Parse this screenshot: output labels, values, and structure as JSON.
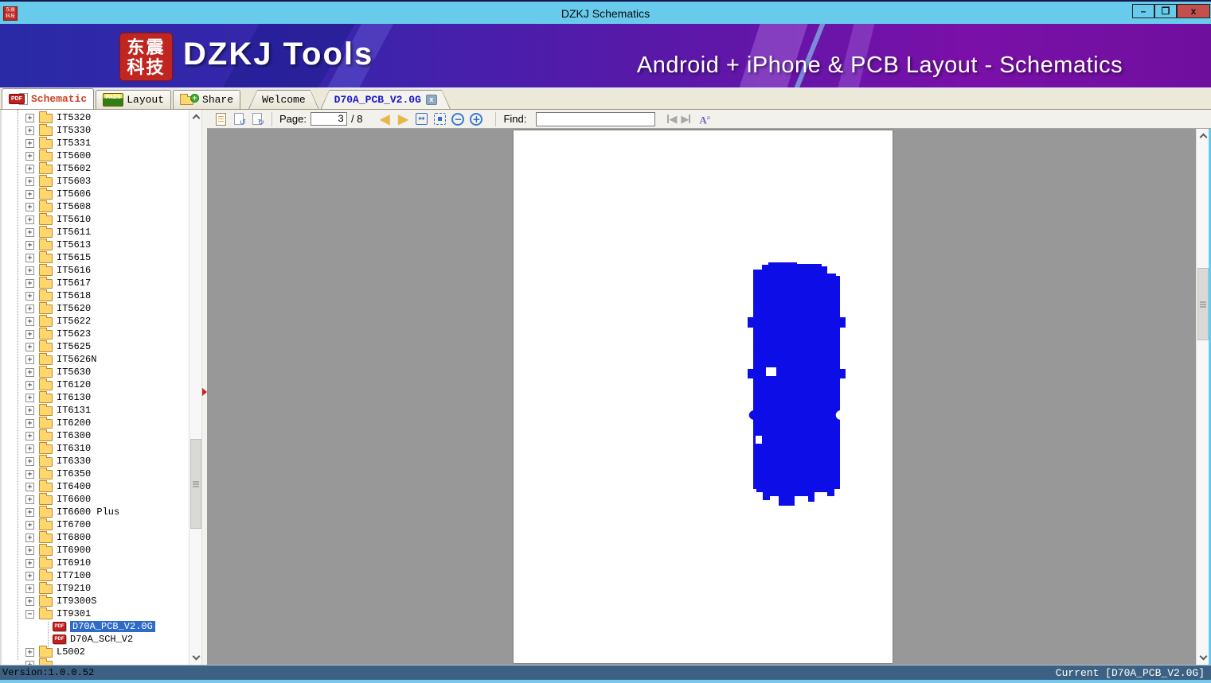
{
  "window": {
    "title": "DZKJ Schematics",
    "controls": {
      "minimize": "–",
      "maximize": "❐",
      "close": "x"
    }
  },
  "banner": {
    "logo_line1": "东震",
    "logo_line2": "科技",
    "app_name": "DZKJ Tools",
    "tagline": "Android + iPhone & PCB Layout - Schematics"
  },
  "tabs": {
    "main": [
      {
        "label": "Schematic",
        "icon": "pdf",
        "active": true
      },
      {
        "label": "Layout",
        "icon": "pads",
        "active": false
      },
      {
        "label": "Share",
        "icon": "share-folder",
        "active": false
      }
    ],
    "documents": [
      {
        "label": "Welcome",
        "active": false
      },
      {
        "label": "D70A_PCB_V2.0G",
        "active": true,
        "close_glyph": "x"
      }
    ]
  },
  "toolbar": {
    "page_label": "Page:",
    "page_value": "3",
    "page_total": "/ 8",
    "find_label": "Find:",
    "find_value": "",
    "pads_icon_text": "PADS",
    "pdf_badge_text": "PDF",
    "fit_width_glyph": "↔",
    "zoom_out_glyph": "−",
    "zoom_in_glyph": "+",
    "prev_glyph": "◀",
    "next_glyph": "▶",
    "case_glyph": "A",
    "case_sup_glyph": "a",
    "rotate_left_glyph": "↺",
    "rotate_right_glyph": "↻",
    "share_plus_glyph": "+"
  },
  "tree": {
    "items": [
      {
        "label": "IT5320",
        "type": "folder",
        "state": "collapsed"
      },
      {
        "label": "IT5330",
        "type": "folder",
        "state": "collapsed"
      },
      {
        "label": "IT5331",
        "type": "folder",
        "state": "collapsed"
      },
      {
        "label": "IT5600",
        "type": "folder",
        "state": "collapsed"
      },
      {
        "label": "IT5602",
        "type": "folder",
        "state": "collapsed"
      },
      {
        "label": "IT5603",
        "type": "folder",
        "state": "collapsed"
      },
      {
        "label": "IT5606",
        "type": "folder",
        "state": "collapsed"
      },
      {
        "label": "IT5608",
        "type": "folder",
        "state": "collapsed"
      },
      {
        "label": "IT5610",
        "type": "folder",
        "state": "collapsed"
      },
      {
        "label": "IT5611",
        "type": "folder",
        "state": "collapsed"
      },
      {
        "label": "IT5613",
        "type": "folder",
        "state": "collapsed"
      },
      {
        "label": "IT5615",
        "type": "folder",
        "state": "collapsed"
      },
      {
        "label": "IT5616",
        "type": "folder",
        "state": "collapsed"
      },
      {
        "label": "IT5617",
        "type": "folder",
        "state": "collapsed"
      },
      {
        "label": "IT5618",
        "type": "folder",
        "state": "collapsed"
      },
      {
        "label": "IT5620",
        "type": "folder",
        "state": "collapsed"
      },
      {
        "label": "IT5622",
        "type": "folder",
        "state": "collapsed"
      },
      {
        "label": "IT5623",
        "type": "folder",
        "state": "collapsed"
      },
      {
        "label": "IT5625",
        "type": "folder",
        "state": "collapsed"
      },
      {
        "label": "IT5626N",
        "type": "folder",
        "state": "collapsed"
      },
      {
        "label": "IT5630",
        "type": "folder",
        "state": "collapsed"
      },
      {
        "label": "IT6120",
        "type": "folder",
        "state": "collapsed"
      },
      {
        "label": "IT6130",
        "type": "folder",
        "state": "collapsed"
      },
      {
        "label": "IT6131",
        "type": "folder",
        "state": "collapsed"
      },
      {
        "label": "IT6200",
        "type": "folder",
        "state": "collapsed"
      },
      {
        "label": "IT6300",
        "type": "folder",
        "state": "collapsed"
      },
      {
        "label": "IT6310",
        "type": "folder",
        "state": "collapsed"
      },
      {
        "label": "IT6330",
        "type": "folder",
        "state": "collapsed"
      },
      {
        "label": "IT6350",
        "type": "folder",
        "state": "collapsed"
      },
      {
        "label": "IT6400",
        "type": "folder",
        "state": "collapsed"
      },
      {
        "label": "IT6600",
        "type": "folder",
        "state": "collapsed"
      },
      {
        "label": "IT6600 Plus",
        "type": "folder",
        "state": "collapsed"
      },
      {
        "label": "IT6700",
        "type": "folder",
        "state": "collapsed"
      },
      {
        "label": "IT6800",
        "type": "folder",
        "state": "collapsed"
      },
      {
        "label": "IT6900",
        "type": "folder",
        "state": "collapsed"
      },
      {
        "label": "IT6910",
        "type": "folder",
        "state": "collapsed"
      },
      {
        "label": "IT7100",
        "type": "folder",
        "state": "collapsed"
      },
      {
        "label": "IT9210",
        "type": "folder",
        "state": "collapsed"
      },
      {
        "label": "IT9300S",
        "type": "folder",
        "state": "collapsed"
      },
      {
        "label": "IT9301",
        "type": "folder",
        "state": "expanded"
      },
      {
        "label": "D70A_PCB_V2.0G",
        "type": "pdf",
        "selected": true
      },
      {
        "label": "D70A_SCH_V2",
        "type": "pdf",
        "selected": false
      },
      {
        "label": "L5002",
        "type": "folder",
        "state": "collapsed"
      },
      {
        "label": "",
        "type": "folder",
        "state": "collapsed"
      }
    ]
  },
  "status_bar": {
    "left": "Version:1.0.0.52",
    "right": "Current [D70A_PCB_V2.0G]"
  },
  "colors": {
    "titlebar": "#68CBEC",
    "banner_right": "#7A10A8",
    "accent_red": "#C0261F",
    "tab_active_text": "#CC4125",
    "doc_tab_active_text": "#1818C8",
    "selection_bg": "#2E6AC8",
    "pcb_blue": "#0D0DE8",
    "viewer_bg": "#989898",
    "statusbar_bg": "#3C6182",
    "statusbar_stripe": "#74C9EC"
  }
}
